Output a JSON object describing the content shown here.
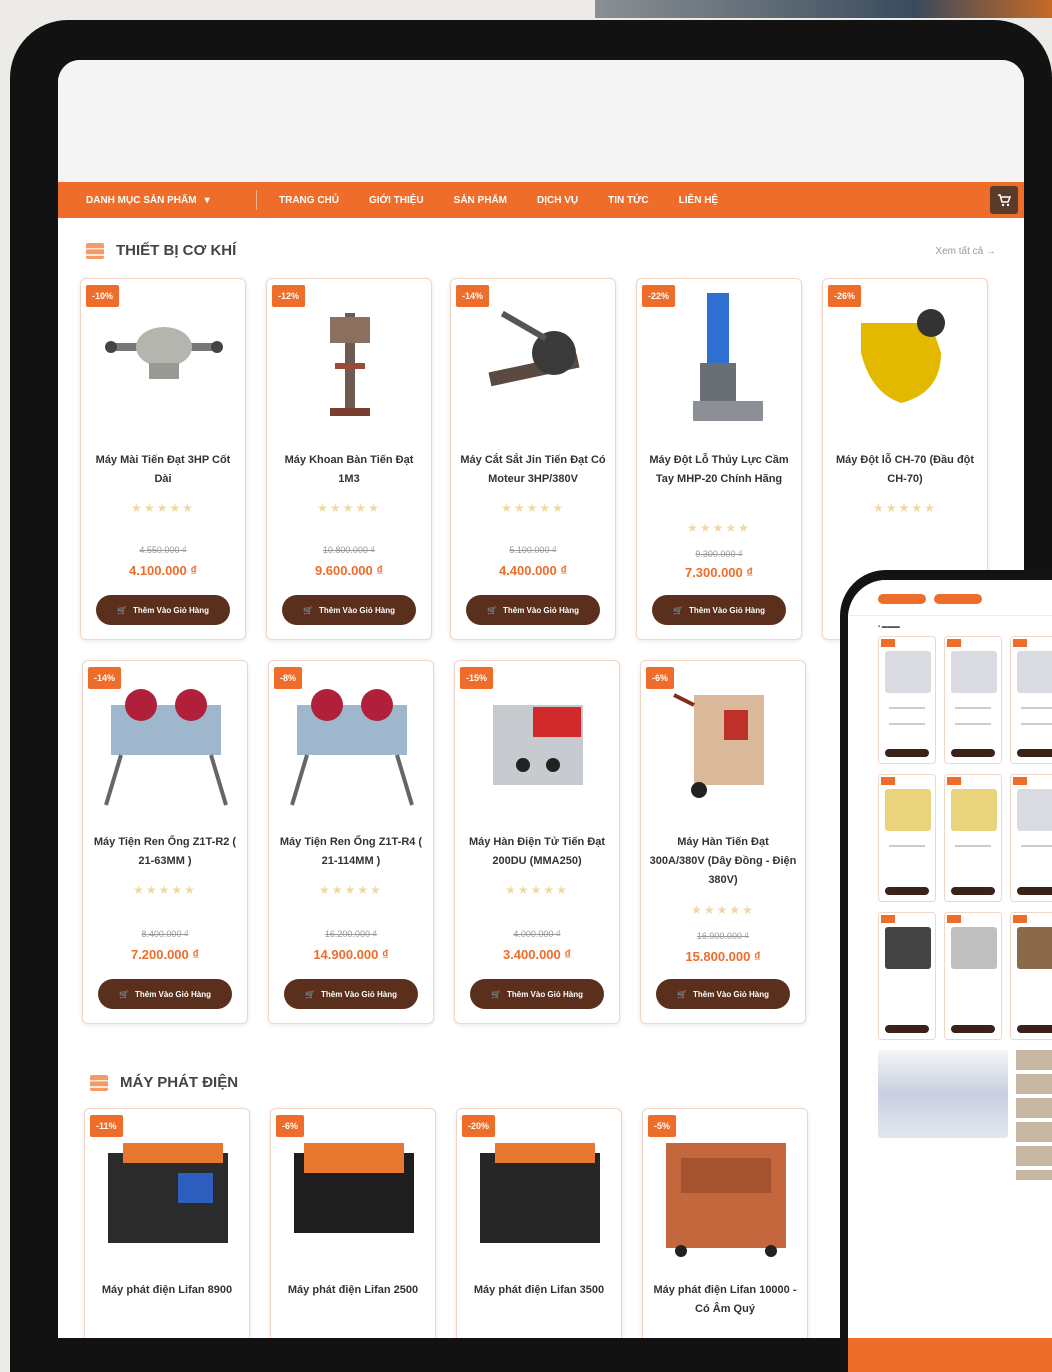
{
  "nav": {
    "category": "DANH MỤC SẢN PHẨM",
    "items": [
      "TRANG CHỦ",
      "GIỚI THIỆU",
      "SẢN PHẨM",
      "DỊCH VỤ",
      "TIN TỨC",
      "LIÊN HỆ"
    ]
  },
  "sections": {
    "mechanical": {
      "title": "THIẾT BỊ CƠ KHÍ",
      "view_all": "Xem tất cả"
    },
    "generators": {
      "title": "MÁY PHÁT ĐIỆN"
    }
  },
  "products_row1": [
    {
      "badge": "-10%",
      "name": "Máy Mài Tiến Đạt 3HP Cốt Dài",
      "old_price": "4.550.000 ₫",
      "price": "4.100.000 ₫",
      "button": "Thêm Vào Giỏ Hàng"
    },
    {
      "badge": "-12%",
      "name": "Máy Khoan Bàn Tiến Đạt 1M3",
      "old_price": "10.800.000 ₫",
      "price": "9.600.000 ₫",
      "button": "Thêm Vào Giỏ Hàng"
    },
    {
      "badge": "-14%",
      "name": "Máy Cắt Sắt Jin Tiến Đạt Có Moteur 3HP/380V",
      "old_price": "5.100.000 ₫",
      "price": "4.400.000 ₫",
      "button": "Thêm Vào Giỏ Hàng"
    },
    {
      "badge": "-22%",
      "name": "Máy Đột Lỗ Thủy Lực Cầm Tay MHP-20 Chính Hãng",
      "old_price": "9.300.000 ₫",
      "price": "7.300.000 ₫",
      "button": "Thêm Vào Giỏ Hàng"
    },
    {
      "badge": "-26%",
      "name": "Máy Đột lỗ CH-70 (Đầu đột CH-70)",
      "old_price": "",
      "price": "",
      "button": ""
    }
  ],
  "products_row2": [
    {
      "badge": "-14%",
      "name": "Máy Tiện Ren Ống Z1T-R2 ( 21-63MM )",
      "old_price": "8.400.000 ₫",
      "price": "7.200.000 ₫",
      "button": "Thêm Vào Giỏ Hàng"
    },
    {
      "badge": "-8%",
      "name": "Máy Tiện Ren Ống Z1T-R4 ( 21-114MM )",
      "old_price": "16.200.000 ₫",
      "price": "14.900.000 ₫",
      "button": "Thêm Vào Giỏ Hàng"
    },
    {
      "badge": "-15%",
      "name": "Máy Hàn Điện Tử Tiến Đạt 200DU (MMA250)",
      "old_price": "4.000.000 ₫",
      "price": "3.400.000 ₫",
      "button": "Thêm Vào Giỏ Hàng"
    },
    {
      "badge": "-6%",
      "name": "Máy Hàn Tiến Đạt 300A/380V (Dây Đồng - Điện 380V)",
      "old_price": "16.900.000 ₫",
      "price": "15.800.000 ₫",
      "button": "Thêm Vào Giỏ Hàng"
    }
  ],
  "products_row3": [
    {
      "badge": "-11%",
      "name": "Máy phát điện Lifan 8900"
    },
    {
      "badge": "-6%",
      "name": "Máy phát điện Lifan 2500"
    },
    {
      "badge": "-20%",
      "name": "Máy phát điện Lifan 3500"
    },
    {
      "badge": "-5%",
      "name": "Máy phát điện Lifan 10000 - Có Âm Quý"
    }
  ],
  "stars": "★★★★★",
  "colors": {
    "accent": "#ef6d2a",
    "button": "#5a2f1c"
  }
}
